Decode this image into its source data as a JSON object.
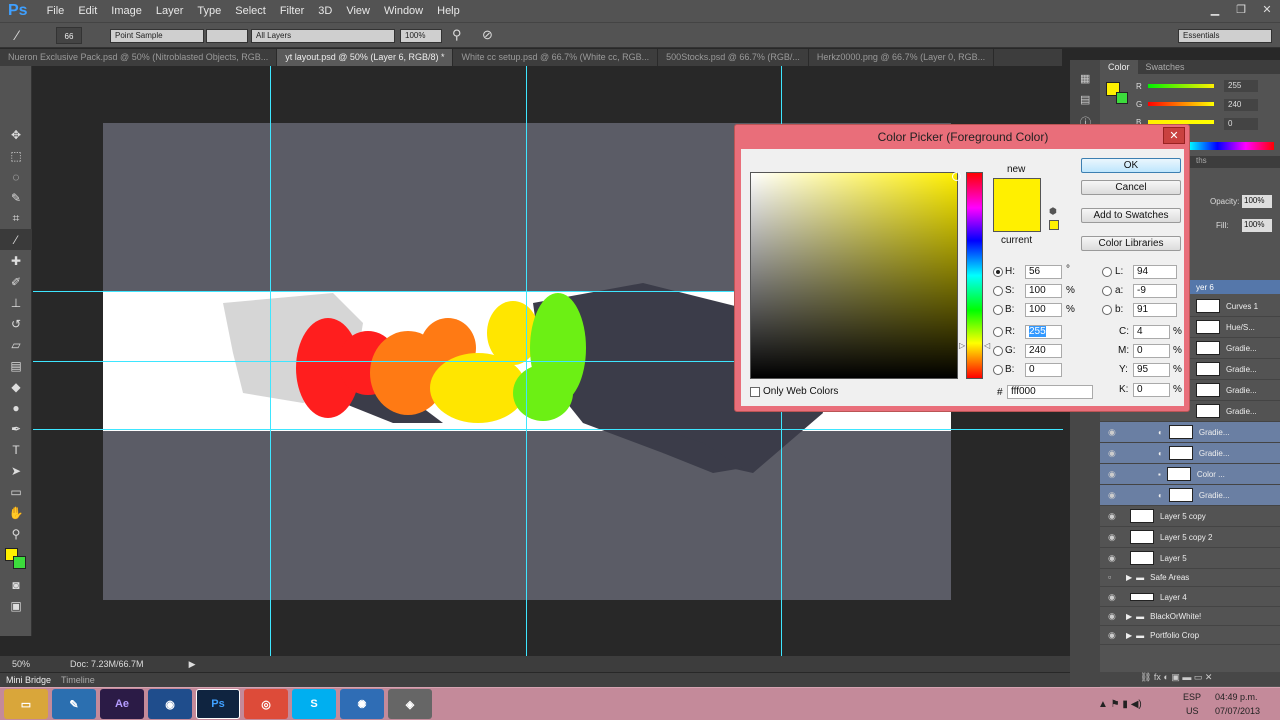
{
  "app": {
    "logo": "Ps"
  },
  "menu": [
    "File",
    "Edit",
    "Image",
    "Layer",
    "Type",
    "Select",
    "Filter",
    "3D",
    "View",
    "Window",
    "Help"
  ],
  "options": {
    "brush_size": "66",
    "sample_size": "Point Sample",
    "sample_layers": "All Layers",
    "zoom_select": "100%",
    "workspace": "Essentials"
  },
  "tabs": [
    {
      "label": "Nueron Exclusive Pack.psd @ 50% (Nitroblasted Objects, RGB..."
    },
    {
      "label": "yt layout.psd @ 50% (Layer 6, RGB/8) *"
    },
    {
      "label": "White cc setup.psd @ 66.7% (White cc, RGB..."
    },
    {
      "label": "500Stocks.psd @ 66.7% (RGB/..."
    },
    {
      "label": "Herkz0000.png @ 66.7% (Layer 0, RGB..."
    }
  ],
  "status": {
    "zoom": "50%",
    "doc": "Doc: 7.23M/66.7M"
  },
  "bottom_tabs": [
    "Mini Bridge",
    "Timeline"
  ],
  "color_panel": {
    "tabs": [
      "Color",
      "Swatches"
    ],
    "r": "255",
    "g": "240",
    "b": "0"
  },
  "layers_panel": {
    "tab_partial": "ths",
    "opacity_label": "Opacity:",
    "opacity": "100%",
    "fill_label": "Fill:",
    "fill": "100%",
    "selected_partial": "yer 6",
    "rows": [
      "Curves 1",
      "Hue/S...",
      "Gradie...",
      "Gradie...",
      "Gradie...",
      "Gradie...",
      "Gradie...",
      "Gradie...",
      "Color ...",
      "Gradie...",
      "Layer 5 copy",
      "Layer 5 copy 2",
      "Layer 5",
      "Safe Areas",
      "Layer 4",
      "BlackOrWhite!",
      "Portfolio Crop"
    ]
  },
  "dialog": {
    "title": "Color Picker (Foreground Color)",
    "new_label": "new",
    "current_label": "current",
    "new_color": "#fff000",
    "current_color": "#fff000",
    "ok": "OK",
    "cancel": "Cancel",
    "add_swatches": "Add to Swatches",
    "libraries": "Color Libraries",
    "only_web": "Only Web Colors",
    "h": "56",
    "s": "100",
    "b": "100",
    "r": "255",
    "g": "240",
    "bl": "0",
    "L": "94",
    "a": "-9",
    "lab_b": "91",
    "c": "4",
    "m": "0",
    "y": "95",
    "k": "0",
    "hex_label": "#",
    "hex": "fff000",
    "deg": "°",
    "pct": "%"
  },
  "taskbar": {
    "lang": "ESP",
    "region": "US",
    "time": "04:49 p.m.",
    "date": "07/07/2013",
    "apps": [
      "Ae",
      "Ps"
    ]
  },
  "colors": {
    "accent": "#3fa0ff",
    "fg_swatch": "#fff000",
    "dialog_frame": "#e96e7a"
  }
}
